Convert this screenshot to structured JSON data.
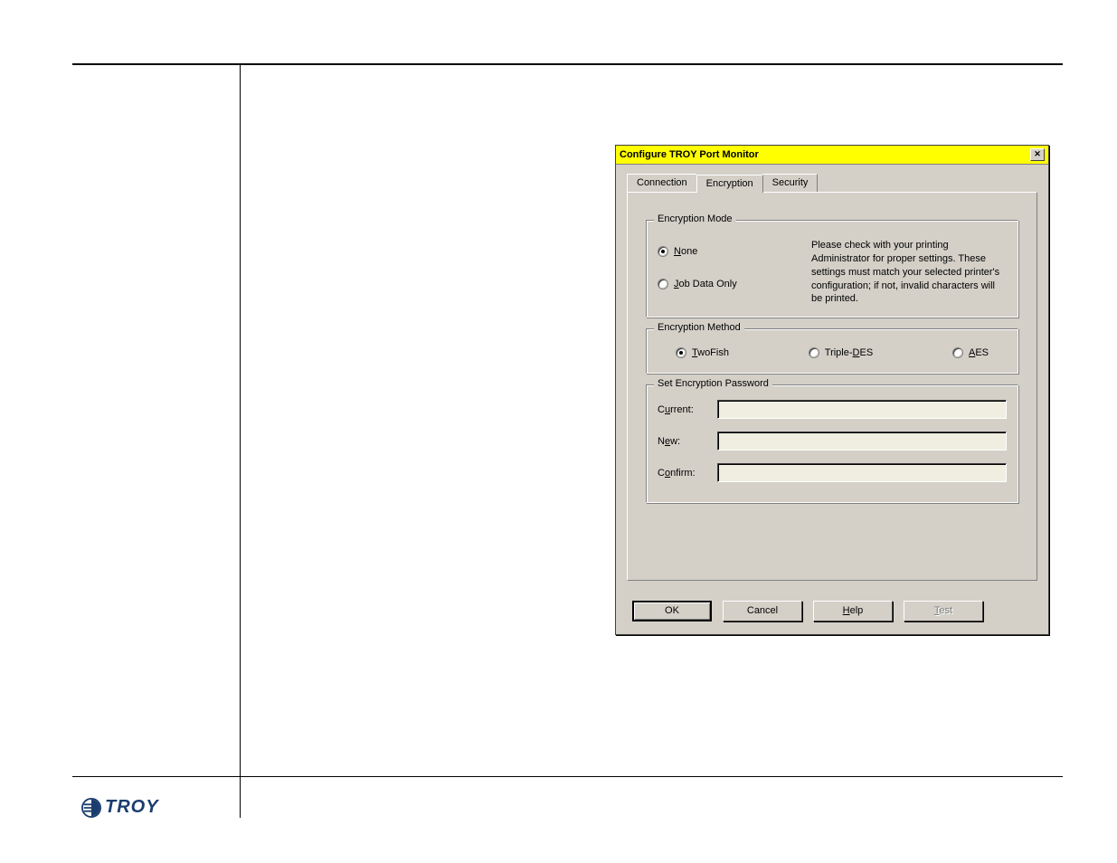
{
  "logo": {
    "text": "TROY"
  },
  "dialog": {
    "title": "Configure TROY Port Monitor",
    "tabs": {
      "connection": "Connection",
      "encryption": "Encryption",
      "security": "Security"
    },
    "mode": {
      "legend": "Encryption Mode",
      "none": "None",
      "job": "Job Data Only",
      "help": "Please check with your printing Administrator for proper settings. These settings must match your selected printer's configuration; if not, invalid characters will be printed."
    },
    "method": {
      "legend": "Encryption Method",
      "twofish": "TwoFish",
      "tripledes": "Triple-DES",
      "aes": "AES"
    },
    "password": {
      "legend": "Set Encryption Password",
      "current": "Current:",
      "new": "New:",
      "confirm": "Confirm:"
    },
    "buttons": {
      "ok": "OK",
      "cancel": "Cancel",
      "help": "Help",
      "test": "Test"
    }
  }
}
